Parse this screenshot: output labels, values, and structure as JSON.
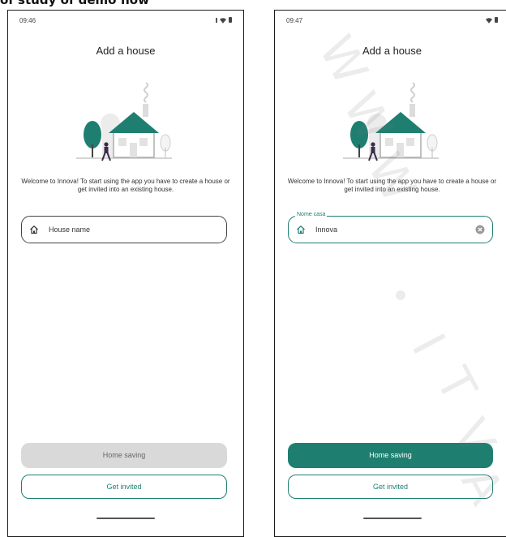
{
  "caption": "of study of demo flow",
  "screens": [
    {
      "status_time": "09:46",
      "title": "Add a house",
      "welcome_text": "Welcome to Innova! To start using the app you have to create a house or get invited into an existing house.",
      "house_field": {
        "placeholder": "House name",
        "value": "",
        "floating_label": "",
        "state": "empty"
      },
      "primary_button": {
        "label": "Home saving",
        "state": "disabled"
      },
      "secondary_button": {
        "label": "Get invited"
      }
    },
    {
      "status_time": "09:47",
      "title": "Add a house",
      "welcome_text": "Welcome to Innova! To start using the app you have to create a house or get invited into an existing house.",
      "house_field": {
        "placeholder": "",
        "value": "Innova",
        "floating_label": "Nome casa",
        "state": "filled"
      },
      "primary_button": {
        "label": "Home saving",
        "state": "enabled"
      },
      "secondary_button": {
        "label": "Get invited"
      }
    }
  ],
  "icons": {
    "field_leading": "home-outline-icon",
    "field_trailing": "clear-circle-icon",
    "status": [
      "signal-icon",
      "wifi-icon",
      "battery-icon"
    ]
  },
  "colors": {
    "accent": "#1e7f70",
    "disabled_button": "#d9d9d9",
    "tree": "#1e7f70",
    "illustration_gray": "#e8e8e8"
  },
  "watermark": {
    "chars": [
      "W",
      "W",
      "W",
      "I",
      "T",
      "V",
      "A"
    ]
  }
}
